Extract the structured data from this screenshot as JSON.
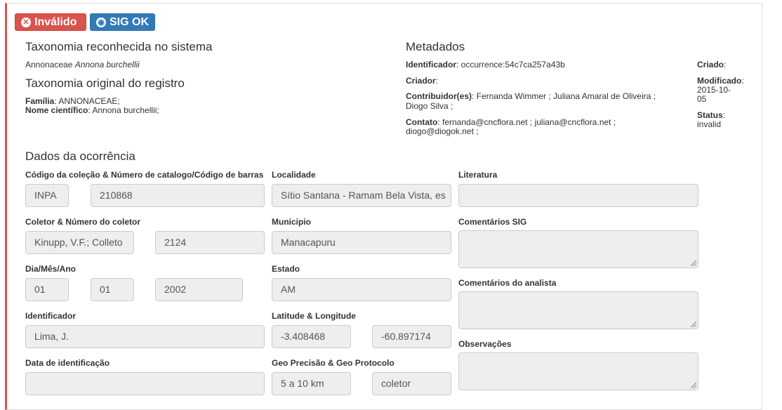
{
  "badges": {
    "invalid_label": "Inválido",
    "sig_label": "SIG OK"
  },
  "taxonomy": {
    "recognized_title": "Taxonomia reconhecida no sistema",
    "recognized_family": "Annonaceae",
    "recognized_species": "Annona burchellii",
    "original_title": "Taxonomia original do registro",
    "family_label": "Família",
    "family_value": ": ANNONACEAE;",
    "scientific_label": "Nome científico",
    "scientific_value": ": Annona burchellii;"
  },
  "metadata": {
    "title": "Metadados",
    "identifier_label": "Identificador",
    "identifier_value": ": occurrence:54c7ca257a43b",
    "creator_label": "Criador",
    "creator_value": ":",
    "contributors_label": "Contribuidor(es)",
    "contributors_value_line1": ": Fernanda Wimmer ; Juliana Amaral de Oliveira ;",
    "contributors_value_line2": "Diogo Silva ;",
    "contact_label": "Contato",
    "contact_value_line1": ": fernanda@cncflora.net ; juliana@cncflora.net ;",
    "contact_value_line2": "diogo@diogok.net ;",
    "created_label": "Criado",
    "created_value": ":",
    "modified_label": "Modificado",
    "modified_value": ":",
    "modified_date_line1": "2015-10-",
    "modified_date_line2": "05",
    "status_label": "Status",
    "status_value": ":",
    "status_text": "invalid"
  },
  "occurrence": {
    "title": "Dados da ocorrência",
    "collection_label": "Código da coleção & Número de catalogo/Código de barras",
    "collection_code": "INPA",
    "catalog_number": "210868",
    "collector_label": "Coletor & Número do coletor",
    "collector": "Kinupp, V.F.; Colleto",
    "collector_number": "2124",
    "date_label": "Dia/Mês/Ano",
    "day": "01",
    "month": "01",
    "year": "2002",
    "identifier_label": "Identificador",
    "identifier": "Lima, J.",
    "id_date_label": "Data de identificação",
    "id_date": "",
    "locality_label": "Localidade",
    "locality": "Sítio Santana - Ramam Bela Vista, es",
    "municipality_label": "Municipio",
    "municipality": "Manacapuru",
    "state_label": "Estado",
    "state": "AM",
    "latlon_label": "Latitude & Longitude",
    "latitude": "-3.408468",
    "longitude": "-60.897174",
    "geo_label": "Geo Precisão & Geo Protocolo",
    "geo_precision": "5 a 10 km",
    "geo_protocol": "coletor",
    "literature_label": "Literatura",
    "literature": "",
    "sig_comments_label": "Comentários SIG",
    "analyst_comments_label": "Comentários do analista",
    "observations_label": "Observações"
  }
}
